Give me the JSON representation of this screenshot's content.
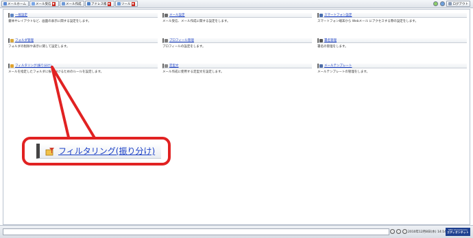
{
  "toolbar": {
    "buttons": [
      {
        "label": "メールホーム",
        "icon": "home-icon",
        "color": "#5b8bd6"
      },
      {
        "label": "メール受信",
        "icon": "inbox-icon",
        "color": "#7aa7e8"
      },
      {
        "label": "メール作成",
        "icon": "compose-icon",
        "color": "#6e9ad8"
      },
      {
        "label": "アドレス帳",
        "icon": "address-book-icon",
        "color": "#4f82c9"
      },
      {
        "label": "ツール",
        "icon": "tools-icon",
        "color": "#6a9ad6"
      }
    ],
    "logout_label": "ログアウト"
  },
  "settings": [
    {
      "title": "一般設定",
      "desc": "書体やレイアウトなど、画面の表示に関する設定をします。",
      "icon": "general-settings-icon",
      "icon_color": "#5f86c4"
    },
    {
      "title": "メール設定",
      "desc": "メール受信、メール作成に関する設定をします。",
      "icon": "mail-settings-icon",
      "icon_color": "#6b6b6b"
    },
    {
      "title": "スマートフォン設定",
      "desc": "スマートフォン端末から Webメール にアクセスする際の設定をします。",
      "icon": "smartphone-icon",
      "icon_color": "#4a6fb0"
    },
    {
      "title": "フォルダ管理",
      "desc": "フォルダの削除や表示に関して設定します。",
      "icon": "folder-icon",
      "icon_color": "#d9a73a"
    },
    {
      "title": "プロフィール管理",
      "desc": "プロフィールの設定をします。",
      "icon": "profile-icon",
      "icon_color": "#7b7b7b"
    },
    {
      "title": "署名管理",
      "desc": "署名の管理をします。",
      "icon": "signature-icon",
      "icon_color": "#555555"
    },
    {
      "title": "フィルタリング(振り分け)",
      "desc": "メールを指定したフォルダに振り分けるためのルールを設定します。",
      "icon": "filter-icon",
      "icon_color": "#e0a32f"
    },
    {
      "title": "定型文",
      "desc": "メール作成に使用する定型文を設定します。",
      "icon": "template-text-icon",
      "icon_color": "#8a8a8a"
    },
    {
      "title": "メールテンプレート",
      "desc": "メールテンプレートの管理をします。",
      "icon": "mail-template-icon",
      "icon_color": "#4e6ea8"
    }
  ],
  "callout": {
    "label": "フィルタリング(振り分け)",
    "accent": "#e12222"
  },
  "status": {
    "datetime": "2010年12月8日(水) 14:14",
    "brand_top": "NIFTY Internet Service",
    "brand_name": "エディオンネット"
  }
}
